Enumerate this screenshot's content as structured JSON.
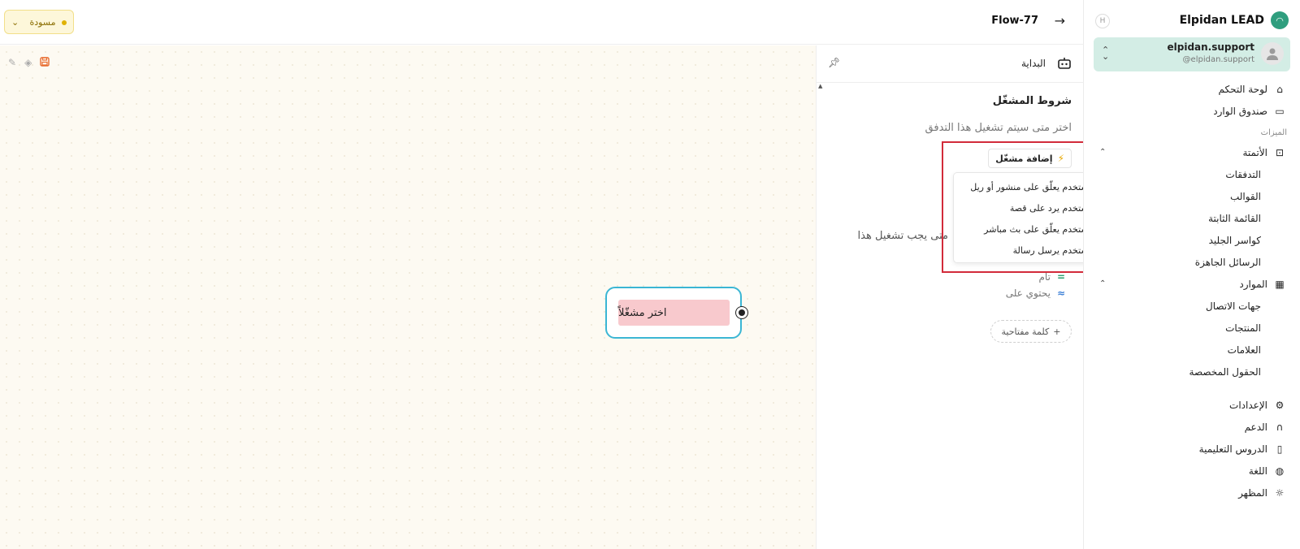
{
  "brand": {
    "name": "Elpidan LEAD",
    "logo_icon": "logo-icon",
    "collapse_label": "H"
  },
  "account": {
    "username": "elpidan.support",
    "handle": "@elpidan.support"
  },
  "topbar": {
    "flow_title": "Flow-77",
    "status_label": "مسودة",
    "status_color": "#e0b100"
  },
  "nav": {
    "top_items": [
      {
        "label": "لوحة التحكم",
        "icon": "home-icon"
      },
      {
        "label": "صندوق الوارد",
        "icon": "inbox-icon"
      }
    ],
    "section_label": "الميزات",
    "automation": {
      "label": "الأتمتة",
      "icon": "robot-icon",
      "children": [
        "التدفقات",
        "القوالب",
        "القائمة الثابتة",
        "كواسر الجليد",
        "الرسائل الجاهزة"
      ]
    },
    "resources": {
      "label": "الموارد",
      "icon": "building-icon",
      "children": [
        "جهات الاتصال",
        "المنتجات",
        "العلامات",
        "الحقول المخصصة"
      ]
    },
    "bottom_items": [
      {
        "label": "الإعدادات",
        "icon": "gear-icon"
      },
      {
        "label": "الدعم",
        "icon": "headset-icon"
      },
      {
        "label": "الدروس التعليمية",
        "icon": "book-icon"
      },
      {
        "label": "اللغة",
        "icon": "globe-icon"
      },
      {
        "label": "المظهر",
        "icon": "sun-icon"
      }
    ]
  },
  "panel": {
    "title": "البداية",
    "section_title": "شروط المشغّل",
    "section_subtitle": "اختر متى سيتم تشغيل هذا التدفق",
    "add_trigger_label": "إضافة مشغّل",
    "partial_text": "متى يجب تشغيل هذا",
    "match_options": [
      {
        "symbol": "=",
        "label": "تام"
      },
      {
        "symbol": "≈",
        "label": "يحتوي على"
      }
    ],
    "keyword_button": "كلمة مفتاحية",
    "dropdown_items": [
      "المستخدم يعلّق على منشور أو ريل",
      "المستخدم يرد على قصة",
      "المستخدم يعلّق على بث مباشر",
      "المستخدم يرسل رسالة"
    ]
  },
  "canvas": {
    "node_label": "اختر مشغّلاً"
  },
  "colors": {
    "accent": "#3bb6d4",
    "highlight": "#d22b3a",
    "account_bg": "#d3ede5"
  }
}
